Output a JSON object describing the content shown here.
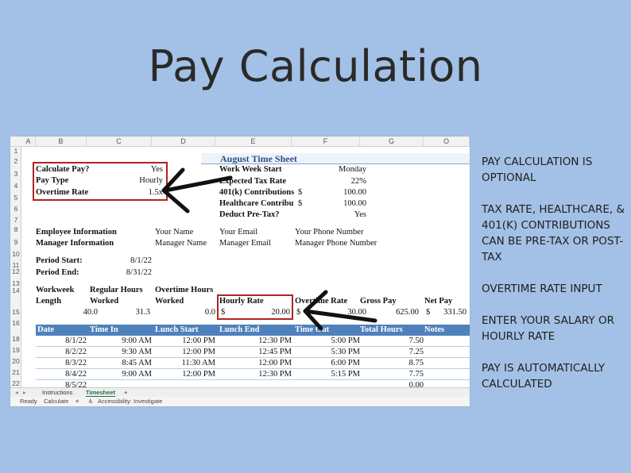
{
  "title": "Pay Calculation",
  "notes": [
    "PAY CALCULATION IS OPTIONAL",
    "TAX RATE, HEALTHCARE, & 401(K) CONTRIBUTIONS CAN BE PRE-TAX OR POST-TAX",
    "OVERTIME RATE INPUT",
    "ENTER YOUR SALARY OR HOURLY RATE",
    "PAY IS AUTOMATICALLY CALCULATED"
  ],
  "columns": [
    "A",
    "B",
    "C",
    "D",
    "E",
    "F",
    "G",
    "O"
  ],
  "rows": [
    "1",
    "2",
    "3",
    "4",
    "5",
    "6",
    "7",
    "8",
    "9",
    "10",
    "11",
    "12",
    "13",
    "14",
    "15",
    "16",
    "18",
    "19",
    "20",
    "21",
    "22",
    "23"
  ],
  "sheet": {
    "title": "August Time Sheet",
    "calculate_pay_label": "Calculate Pay?",
    "calculate_pay_value": "Yes",
    "pay_type_label": "Pay Type",
    "pay_type_value": "Hourly",
    "overtime_rate_label": "Overtime Rate",
    "overtime_rate_value": "1.5x",
    "work_week_start_label": "Work Week Start",
    "work_week_start_value": "Monday",
    "expected_tax_label": "Expected Tax Rate",
    "expected_tax_value": "22%",
    "k401_label": "401(k) Contributions",
    "k401_currency": "$",
    "k401_value": "100.00",
    "healthcare_label": "Healthcare Contribu",
    "healthcare_currency": "$",
    "healthcare_value": "100.00",
    "deduct_pretax_label": "Deduct Pre-Tax?",
    "deduct_pretax_value": "Yes",
    "employee_info_label": "Employee Information",
    "manager_info_label": "Manager Information",
    "your_name": "Your Name",
    "your_email": "Your Email",
    "your_phone": "Your Phone Number",
    "manager_name": "Manager Name",
    "manager_email": "Manager Email",
    "manager_phone": "Manager Phone Number",
    "period_start_label": "Period Start:",
    "period_start_value": "8/1/22",
    "period_end_label": "Period End:",
    "period_end_value": "8/31/22",
    "workweek_label_1": "Workweek",
    "workweek_label_2": "Length",
    "regular_hours_label_1": "Regular Hours",
    "regular_hours_label_2": "Worked",
    "overtime_hours_label_1": "Overtime Hours",
    "overtime_hours_label_2": "Worked",
    "hourly_rate_label": "Hourly Rate",
    "overtime_rate_col_label": "Overtime Rate",
    "gross_pay_label": "Gross Pay",
    "net_pay_label": "Net Pay",
    "workweek_value": "40.0",
    "regular_hours_value": "31.3",
    "overtime_hours_value": "0.0",
    "hourly_currency": "$",
    "hourly_rate_value": "20.00",
    "overtime_currency": "$",
    "overtime_rate_value_hidden": "30.00",
    "gross_pay_value": "625.00",
    "net_pay_currency": "$",
    "net_pay_value": "331.50"
  },
  "table": {
    "headers": [
      "Date",
      "Time In",
      "Lunch Start",
      "Lunch End",
      "Time Out",
      "Total Hours",
      "Notes"
    ],
    "rows": [
      [
        "8/1/22",
        "9:00 AM",
        "12:00 PM",
        "12:30 PM",
        "5:00 PM",
        "7.50"
      ],
      [
        "8/2/22",
        "9:30 AM",
        "12:00 PM",
        "12:45 PM",
        "5:30 PM",
        "7.25"
      ],
      [
        "8/3/22",
        "8:45 AM",
        "11:30 AM",
        "12:00 PM",
        "6:00 PM",
        "8.75"
      ],
      [
        "8/4/22",
        "9:00 AM",
        "12:00 PM",
        "12:30 PM",
        "5:15 PM",
        "7.75"
      ],
      [
        "8/5/22",
        "",
        "",
        "",
        "",
        "0.00"
      ]
    ]
  },
  "tabs": [
    "Instructions",
    "Timesheet",
    "+"
  ],
  "status": [
    "Ready",
    "Calculate",
    "Accessibility: Investigate"
  ],
  "colors": {
    "background": "#a3c1e6",
    "accent": "#4f81bd",
    "highlight_box": "#b22222"
  }
}
